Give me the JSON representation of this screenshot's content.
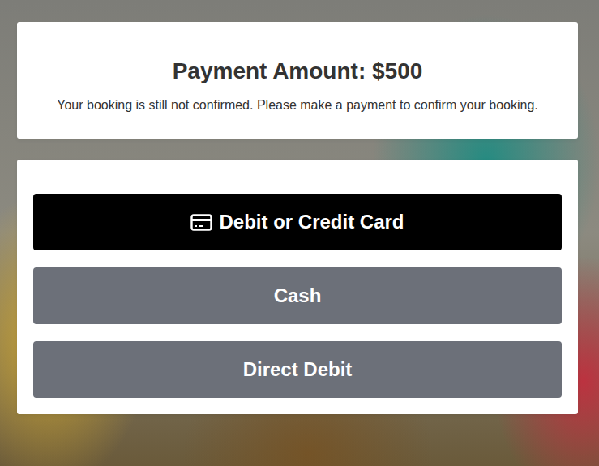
{
  "payment": {
    "title": "Payment Amount: $500",
    "message": "Your booking is still not confirmed. Please make a payment to confirm your booking."
  },
  "methods": [
    {
      "label": "Debit or Credit Card",
      "kind": "card",
      "selected": true
    },
    {
      "label": "Cash",
      "kind": "cash",
      "selected": false
    },
    {
      "label": "Direct Debit",
      "kind": "direct-debit",
      "selected": false
    }
  ]
}
